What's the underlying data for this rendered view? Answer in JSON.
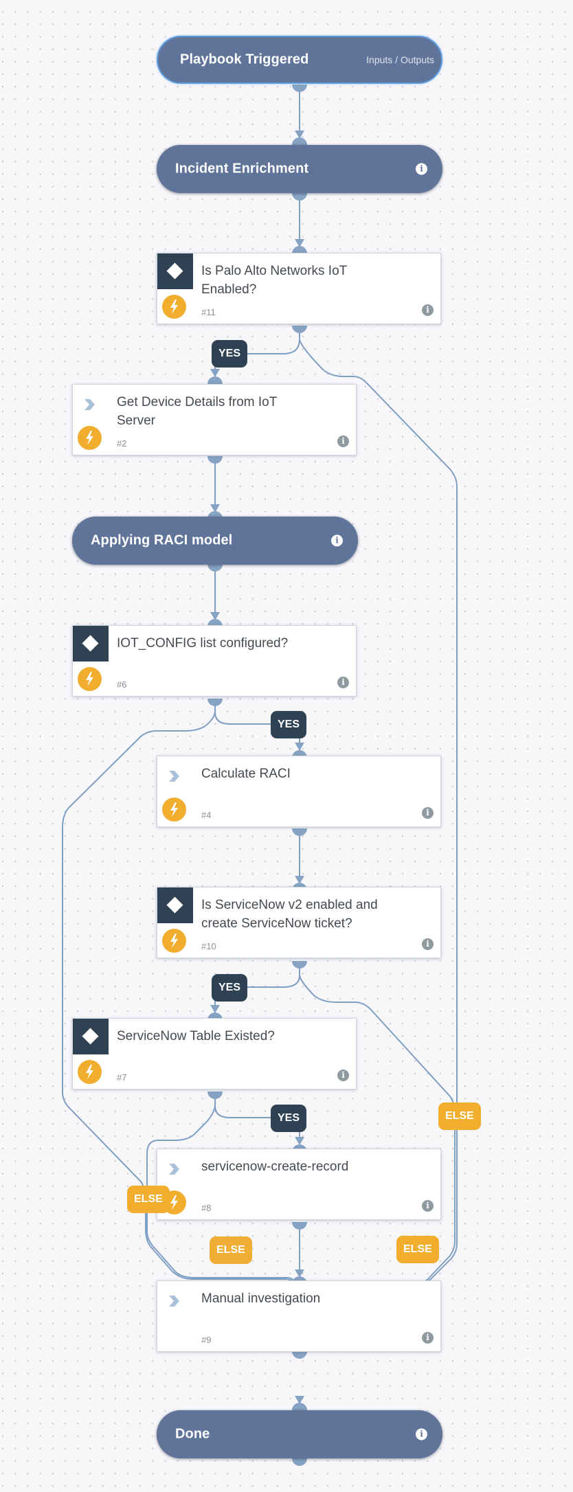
{
  "colors": {
    "section_node": "#5f7498",
    "condition_header": "#2f4254",
    "automation_badge": "#f0ad2e",
    "edge": "#7e9ec2",
    "yes_tag": "#2f4254",
    "else_tag": "#f0ad2e",
    "canvas": "#f7f7fa"
  },
  "start_node": {
    "title": "Playbook Triggered",
    "io_link": "Inputs / Outputs"
  },
  "sections": {
    "incident_enrichment": {
      "title": "Incident Enrichment",
      "icon": "info-icon"
    },
    "applying_raci": {
      "title": "Applying RACI model",
      "icon": "info-icon"
    },
    "done": {
      "title": "Done",
      "icon": "info-icon"
    }
  },
  "tasks": {
    "t11": {
      "type": "condition",
      "label": "Is Palo Alto Networks IoT Enabled?",
      "number": "#11",
      "icon": "diamond-icon",
      "automated": true
    },
    "t2": {
      "type": "regular",
      "label": "Get Device Details from IoT Server",
      "number": "#2",
      "icon": "chevron-icon",
      "automated": true
    },
    "t6": {
      "type": "condition",
      "label": "IOT_CONFIG list configured?",
      "number": "#6",
      "icon": "diamond-icon",
      "automated": true
    },
    "t4": {
      "type": "regular",
      "label": "Calculate RACI",
      "number": "#4",
      "icon": "chevron-icon",
      "automated": true
    },
    "t10": {
      "type": "condition",
      "label": "Is ServiceNow v2 enabled and create ServiceNow ticket?",
      "number": "#10",
      "icon": "diamond-icon",
      "automated": true
    },
    "t7": {
      "type": "condition",
      "label": "ServiceNow Table Existed?",
      "number": "#7",
      "icon": "diamond-icon",
      "automated": true
    },
    "t8": {
      "type": "regular",
      "label": "servicenow-create-record",
      "number": "#8",
      "icon": "chevron-icon",
      "automated": true
    },
    "t9": {
      "type": "regular",
      "label": "Manual investigation",
      "number": "#9",
      "icon": "chevron-icon",
      "automated": false
    }
  },
  "branch_labels": {
    "yes": "YES",
    "else": "ELSE"
  },
  "edges": [
    {
      "from": "Playbook Triggered",
      "to": "Incident Enrichment"
    },
    {
      "from": "Incident Enrichment",
      "to": "#11"
    },
    {
      "from": "#11",
      "to": "#2",
      "label": "YES"
    },
    {
      "from": "#11",
      "to": "#9",
      "label": "ELSE"
    },
    {
      "from": "#2",
      "to": "Applying RACI model"
    },
    {
      "from": "Applying RACI model",
      "to": "#6"
    },
    {
      "from": "#6",
      "to": "#4",
      "label": "YES"
    },
    {
      "from": "#6",
      "to": "#9",
      "label": "ELSE"
    },
    {
      "from": "#4",
      "to": "#10"
    },
    {
      "from": "#10",
      "to": "#7",
      "label": "YES"
    },
    {
      "from": "#10",
      "to": "#9",
      "label": "ELSE"
    },
    {
      "from": "#7",
      "to": "#8",
      "label": "YES"
    },
    {
      "from": "#7",
      "to": "#9",
      "label": "ELSE"
    },
    {
      "from": "#8",
      "to": "#9"
    },
    {
      "from": "#9",
      "to": "Done"
    }
  ]
}
